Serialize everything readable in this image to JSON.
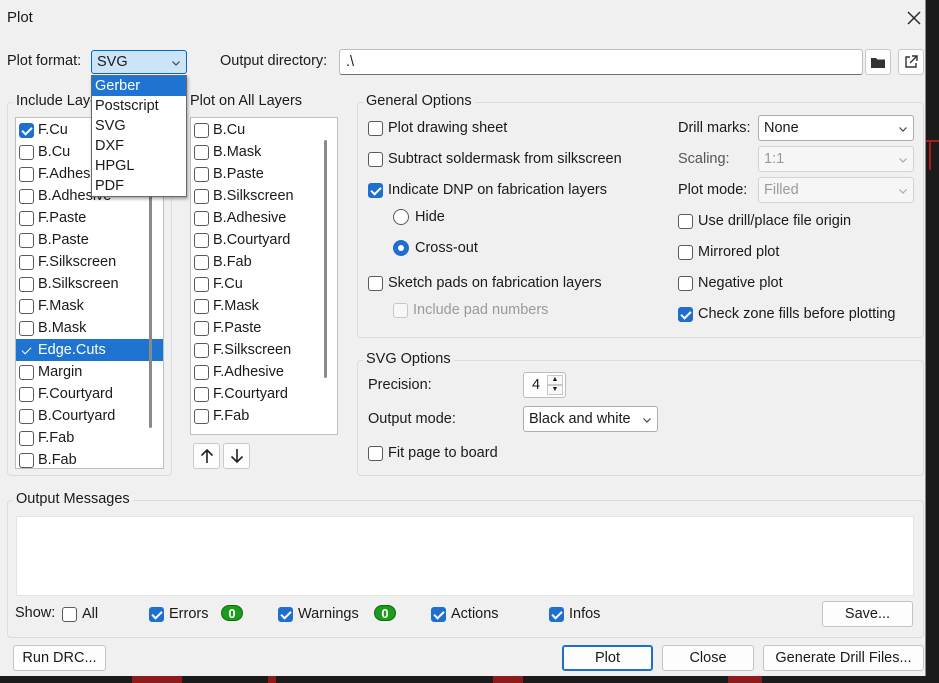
{
  "window": {
    "title": "Plot"
  },
  "format": {
    "label": "Plot format:",
    "value": "SVG",
    "options": [
      "Gerber",
      "Postscript",
      "SVG",
      "DXF",
      "HPGL",
      "PDF"
    ],
    "highlighted": "Gerber"
  },
  "output_dir": {
    "label": "Output directory:",
    "value": ".\\"
  },
  "include_layers": {
    "title": "Include Layers",
    "items": [
      {
        "label": "F.Cu",
        "checked": true
      },
      {
        "label": "B.Cu",
        "checked": false
      },
      {
        "label": "F.Adhesive",
        "checked": false
      },
      {
        "label": "B.Adhesive",
        "checked": false
      },
      {
        "label": "F.Paste",
        "checked": false
      },
      {
        "label": "B.Paste",
        "checked": false
      },
      {
        "label": "F.Silkscreen",
        "checked": false
      },
      {
        "label": "B.Silkscreen",
        "checked": false
      },
      {
        "label": "F.Mask",
        "checked": false
      },
      {
        "label": "B.Mask",
        "checked": false
      },
      {
        "label": "Edge.Cuts",
        "checked": true,
        "selected": true
      },
      {
        "label": "Margin",
        "checked": false
      },
      {
        "label": "F.Courtyard",
        "checked": false
      },
      {
        "label": "B.Courtyard",
        "checked": false
      },
      {
        "label": "F.Fab",
        "checked": false
      },
      {
        "label": "B.Fab",
        "checked": false
      }
    ]
  },
  "plot_all_layers": {
    "title": "Plot on All Layers",
    "items": [
      {
        "label": "B.Cu",
        "checked": false
      },
      {
        "label": "B.Mask",
        "checked": false
      },
      {
        "label": "B.Paste",
        "checked": false
      },
      {
        "label": "B.Silkscreen",
        "checked": false
      },
      {
        "label": "B.Adhesive",
        "checked": false
      },
      {
        "label": "B.Courtyard",
        "checked": false
      },
      {
        "label": "B.Fab",
        "checked": false
      },
      {
        "label": "F.Cu",
        "checked": false
      },
      {
        "label": "F.Mask",
        "checked": false
      },
      {
        "label": "F.Paste",
        "checked": false
      },
      {
        "label": "F.Silkscreen",
        "checked": false
      },
      {
        "label": "F.Adhesive",
        "checked": false
      },
      {
        "label": "F.Courtyard",
        "checked": false
      },
      {
        "label": "F.Fab",
        "checked": false
      }
    ],
    "move_up_icon": "arrow-up-icon",
    "move_down_icon": "arrow-down-icon"
  },
  "general": {
    "title": "General Options",
    "plot_drawing_sheet": {
      "label": "Plot drawing sheet",
      "checked": false
    },
    "subtract_soldermask": {
      "label": "Subtract soldermask from silkscreen",
      "checked": false
    },
    "indicate_dnp": {
      "label": "Indicate DNP on fabrication layers",
      "checked": true
    },
    "dnp_hide": {
      "label": "Hide",
      "checked": false
    },
    "dnp_crossout": {
      "label": "Cross-out",
      "checked": true
    },
    "sketch_pads": {
      "label": "Sketch pads on fabrication layers",
      "checked": false
    },
    "include_pad_numbers": {
      "label": "Include pad numbers",
      "checked": false
    },
    "drill_marks": {
      "label": "Drill marks:",
      "value": "None"
    },
    "scaling": {
      "label": "Scaling:",
      "value": "1:1"
    },
    "plot_mode": {
      "label": "Plot mode:",
      "value": "Filled"
    },
    "use_drill_origin": {
      "label": "Use drill/place file origin",
      "checked": false
    },
    "mirrored": {
      "label": "Mirrored plot",
      "checked": false
    },
    "negative": {
      "label": "Negative plot",
      "checked": false
    },
    "check_zone_fills": {
      "label": "Check zone fills before plotting",
      "checked": true
    }
  },
  "svg_options": {
    "title": "SVG Options",
    "precision_label": "Precision:",
    "precision_value": "4",
    "output_mode_label": "Output mode:",
    "output_mode_value": "Black and white",
    "fit_page": {
      "label": "Fit page to board",
      "checked": false
    }
  },
  "messages": {
    "title": "Output Messages",
    "show_label": "Show:",
    "all": {
      "label": "All",
      "checked": false
    },
    "errors": {
      "label": "Errors",
      "checked": true,
      "count": "0"
    },
    "warnings": {
      "label": "Warnings",
      "checked": true,
      "count": "0"
    },
    "actions": {
      "label": "Actions",
      "checked": true
    },
    "infos": {
      "label": "Infos",
      "checked": true
    },
    "save_label": "Save..."
  },
  "buttons": {
    "run_drc": "Run DRC...",
    "plot": "Plot",
    "close": "Close",
    "generate_drill": "Generate Drill Files..."
  },
  "colors": {
    "accent": "#1f74d2",
    "badge": "#1c9b1c"
  }
}
